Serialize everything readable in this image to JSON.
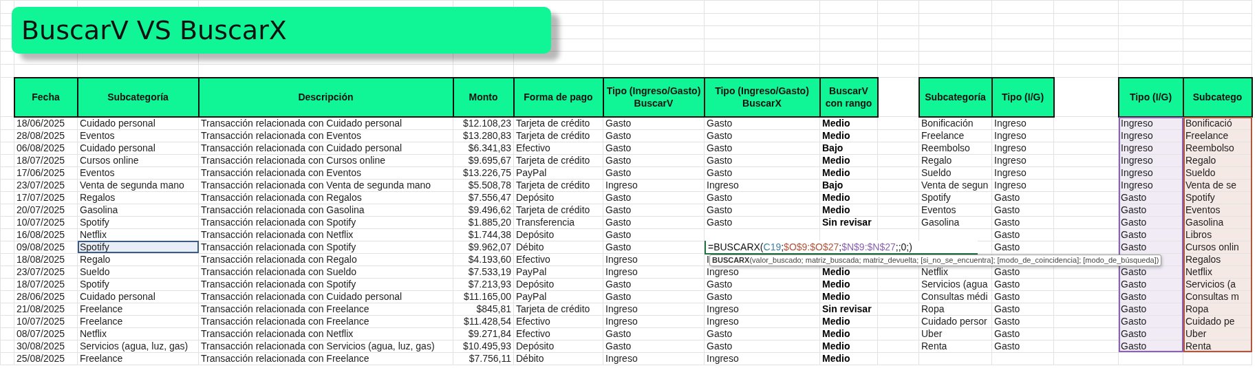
{
  "banner": {
    "title": "BuscarV VS BuscarX"
  },
  "main_table": {
    "columns": [
      "Fecha",
      "Subcategoría",
      "Descripción",
      "Monto",
      "Forma de pago",
      "Tipo (Ingreso/Gasto) BuscarV",
      "Tipo (Ingreso/Gasto) BuscarX",
      "BuscarV con rango"
    ],
    "rows": [
      {
        "selected": false,
        "cells": [
          "18/06/2025",
          "Cuidado personal",
          "Transacción relacionada con Cuidado personal",
          "$12.108,23",
          "Tarjeta de crédito",
          "Gasto",
          "Gasto",
          "Medio"
        ]
      },
      {
        "selected": false,
        "cells": [
          "28/08/2025",
          "Eventos",
          "Transacción relacionada con Eventos",
          "$13.280,83",
          "Tarjeta de crédito",
          "Gasto",
          "Gasto",
          "Medio"
        ]
      },
      {
        "selected": false,
        "cells": [
          "06/08/2025",
          "Cuidado personal",
          "Transacción relacionada con Cuidado personal",
          "$6.341,83",
          "Efectivo",
          "Gasto",
          "Gasto",
          "Bajo"
        ]
      },
      {
        "selected": false,
        "cells": [
          "18/07/2025",
          "Cursos online",
          "Transacción relacionada con Cursos online",
          "$9.695,67",
          "Tarjeta de crédito",
          "Gasto",
          "Gasto",
          "Medio"
        ]
      },
      {
        "selected": false,
        "cells": [
          "17/06/2025",
          "Eventos",
          "Transacción relacionada con Eventos",
          "$13.226,75",
          "PayPal",
          "Gasto",
          "Gasto",
          "Medio"
        ]
      },
      {
        "selected": false,
        "cells": [
          "23/07/2025",
          "Venta de segunda mano",
          "Transacción relacionada con Venta de segunda mano",
          "$5.508,78",
          "Tarjeta de crédito",
          "Ingreso",
          "Ingreso",
          "Bajo"
        ]
      },
      {
        "selected": false,
        "cells": [
          "17/07/2025",
          "Regalos",
          "Transacción relacionada con Regalos",
          "$7.556,47",
          "Depósito",
          "Gasto",
          "Gasto",
          "Medio"
        ]
      },
      {
        "selected": false,
        "cells": [
          "20/07/2025",
          "Gasolina",
          "Transacción relacionada con Gasolina",
          "$9.496,62",
          "Tarjeta de crédito",
          "Gasto",
          "Gasto",
          "Medio"
        ]
      },
      {
        "selected": false,
        "cells": [
          "10/07/2025",
          "Spotify",
          "Transacción relacionada con Spotify",
          "$1.885,20",
          "Transferencia",
          "Gasto",
          "Gasto",
          "Sin revisar"
        ]
      },
      {
        "selected": false,
        "cells": [
          "16/08/2025",
          "Netflix",
          "Transacción relacionada con Netflix",
          "$1.744,38",
          "Depósito",
          "Gasto",
          null,
          null
        ]
      },
      {
        "selected": true,
        "cells": [
          "09/08/2025",
          "Spotify",
          "Transacción relacionada con Spotify",
          "$9.962,07",
          "Débito",
          "Gasto",
          null,
          null
        ],
        "editing_formula": [
          {
            "text": "=BUSCARX("
          },
          {
            "text": "C19",
            "color": "#3f7fa6"
          },
          {
            "text": ";"
          },
          {
            "text": "$O$9:$O$27",
            "color": "#b0553e"
          },
          {
            "text": ";"
          },
          {
            "text": "$N$9:$N$27",
            "color": "#8a62b0"
          },
          {
            "text": ";;0;)"
          }
        ],
        "tooltip": "**BUSCARX**(valor_buscado; matriz_buscada; matriz_devuelta; [si_no_se_encuentra]; [modo_de_coincidencia]; [modo_de_búsqueda])"
      },
      {
        "selected": false,
        "cells": [
          "18/08/2025",
          "Regalo",
          "Transacción relacionada con Regalo",
          "$4.193,60",
          "Efectivo",
          "Ingreso",
          "I",
          null
        ]
      },
      {
        "selected": false,
        "cells": [
          "23/07/2025",
          "Sueldo",
          "Transacción relacionada con Sueldo",
          "$7.533,19",
          "PayPal",
          "Ingreso",
          "Ingreso",
          "Medio"
        ]
      },
      {
        "selected": false,
        "cells": [
          "18/07/2025",
          "Spotify",
          "Transacción relacionada con Spotify",
          "$7.213,93",
          "Depósito",
          "Gasto",
          "Gasto",
          "Medio"
        ]
      },
      {
        "selected": false,
        "cells": [
          "28/06/2025",
          "Cuidado personal",
          "Transacción relacionada con Cuidado personal",
          "$11.165,00",
          "PayPal",
          "Gasto",
          "Gasto",
          "Medio"
        ]
      },
      {
        "selected": false,
        "cells": [
          "21/08/2025",
          "Freelance",
          "Transacción relacionada con Freelance",
          "$845,81",
          "Tarjeta de crédito",
          "Ingreso",
          "Ingreso",
          "Sin revisar"
        ]
      },
      {
        "selected": false,
        "cells": [
          "10/07/2025",
          "Freelance",
          "Transacción relacionada con Freelance",
          "$11.428,54",
          "Efectivo",
          "Ingreso",
          "Ingreso",
          "Medio"
        ]
      },
      {
        "selected": false,
        "cells": [
          "08/07/2025",
          "Netflix",
          "Transacción relacionada con Netflix",
          "$9.271,84",
          "Efectivo",
          "Gasto",
          "Gasto",
          "Medio"
        ]
      },
      {
        "selected": false,
        "cells": [
          "30/08/2025",
          "Servicios (agua, luz, gas)",
          "Transacción relacionada con Servicios (agua, luz, gas)",
          "$10.495,93",
          "Depósito",
          "Gasto",
          "Gasto",
          "Medio"
        ]
      },
      {
        "selected": false,
        "cells": [
          "25/08/2025",
          "Freelance",
          "Transacción relacionada con Freelance",
          "$7.756,11",
          "Débito",
          "Ingreso",
          "Ingreso",
          "Medio"
        ]
      }
    ]
  },
  "lookup_tables": [
    {
      "columns": [
        {
          "label": "Subcategoría"
        },
        {
          "label": "Tipo (I/G)"
        }
      ],
      "rows": [
        [
          "Bonificación",
          "Ingreso"
        ],
        [
          "Freelance",
          "Ingreso"
        ],
        [
          "Reembolso",
          "Ingreso"
        ],
        [
          "Regalo",
          "Ingreso"
        ],
        [
          "Sueldo",
          "Ingreso"
        ],
        [
          "Venta de segun",
          "Ingreso"
        ],
        [
          "Spotify",
          "Gasto"
        ],
        [
          "Eventos",
          "Gasto"
        ],
        [
          "Gasolina",
          "Gasto"
        ],
        [
          null,
          "Gasto"
        ],
        [
          null,
          "Gasto"
        ],
        [
          null,
          null
        ],
        [
          "Netflix",
          "Gasto"
        ],
        [
          "Servicios (agua",
          "Gasto"
        ],
        [
          "Consultas médi",
          "Gasto"
        ],
        [
          "Ropa",
          "Gasto"
        ],
        [
          "Cuidado persor",
          "Gasto"
        ],
        [
          "Uber",
          "Gasto"
        ],
        [
          "Renta",
          "Gasto"
        ]
      ]
    },
    {
      "columns": [
        {
          "label": "Tipo (I/G)",
          "color": "#8a62b0"
        },
        {
          "label": "Subcatego",
          "color": "#b0553e"
        }
      ],
      "rows": [
        [
          "Ingreso",
          "Bonificació"
        ],
        [
          "Ingreso",
          "Freelance"
        ],
        [
          "Ingreso",
          "Reembolso"
        ],
        [
          "Ingreso",
          "Regalo"
        ],
        [
          "Ingreso",
          "Sueldo"
        ],
        [
          "Ingreso",
          "Venta de se"
        ],
        [
          "Gasto",
          "Spotify"
        ],
        [
          "Gasto",
          "Eventos"
        ],
        [
          "Gasto",
          "Gasolina"
        ],
        [
          "Gasto",
          "Libros"
        ],
        [
          "Gasto",
          "Cursos onlin"
        ],
        [
          null,
          "Regalos"
        ],
        [
          "Gasto",
          "Netflix"
        ],
        [
          "Gasto",
          "Servicios (a"
        ],
        [
          "Gasto",
          "Consultas m"
        ],
        [
          "Gasto",
          "Ropa"
        ],
        [
          "Gasto",
          "Cuidado pe"
        ],
        [
          "Gasto",
          "Uber"
        ],
        [
          "Gasto",
          "Renta"
        ]
      ]
    }
  ]
}
